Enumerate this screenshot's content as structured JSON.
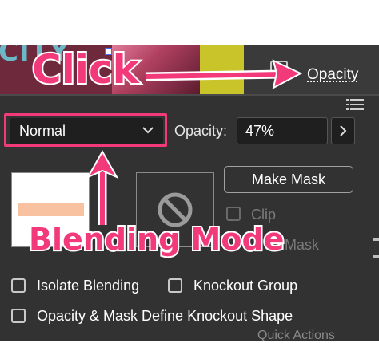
{
  "canvas": {
    "artwork_text": "CITY"
  },
  "annotations": {
    "click": "Click",
    "blending_mode": "Blending Mode",
    "color": "#f23a7b"
  },
  "control_bar": {
    "opacity_link": "Opacity"
  },
  "transparency_panel": {
    "blend_mode": "Normal",
    "opacity_label": "Opacity:",
    "opacity_value": "47%",
    "make_mask_label": "Make Mask",
    "clip_label": "Clip",
    "invert_mask_label": "ert Mask",
    "isolate_blending_label": "Isolate Blending",
    "knockout_group_label": "Knockout Group",
    "opacity_mask_define_label": "Opacity & Mask Define Knockout Shape",
    "cut_off_bottom_text": "Quick Actions"
  },
  "colors": {
    "panel_bg": "#323232",
    "field_bg": "#1f1f1f",
    "highlight": "#f23a7b"
  }
}
